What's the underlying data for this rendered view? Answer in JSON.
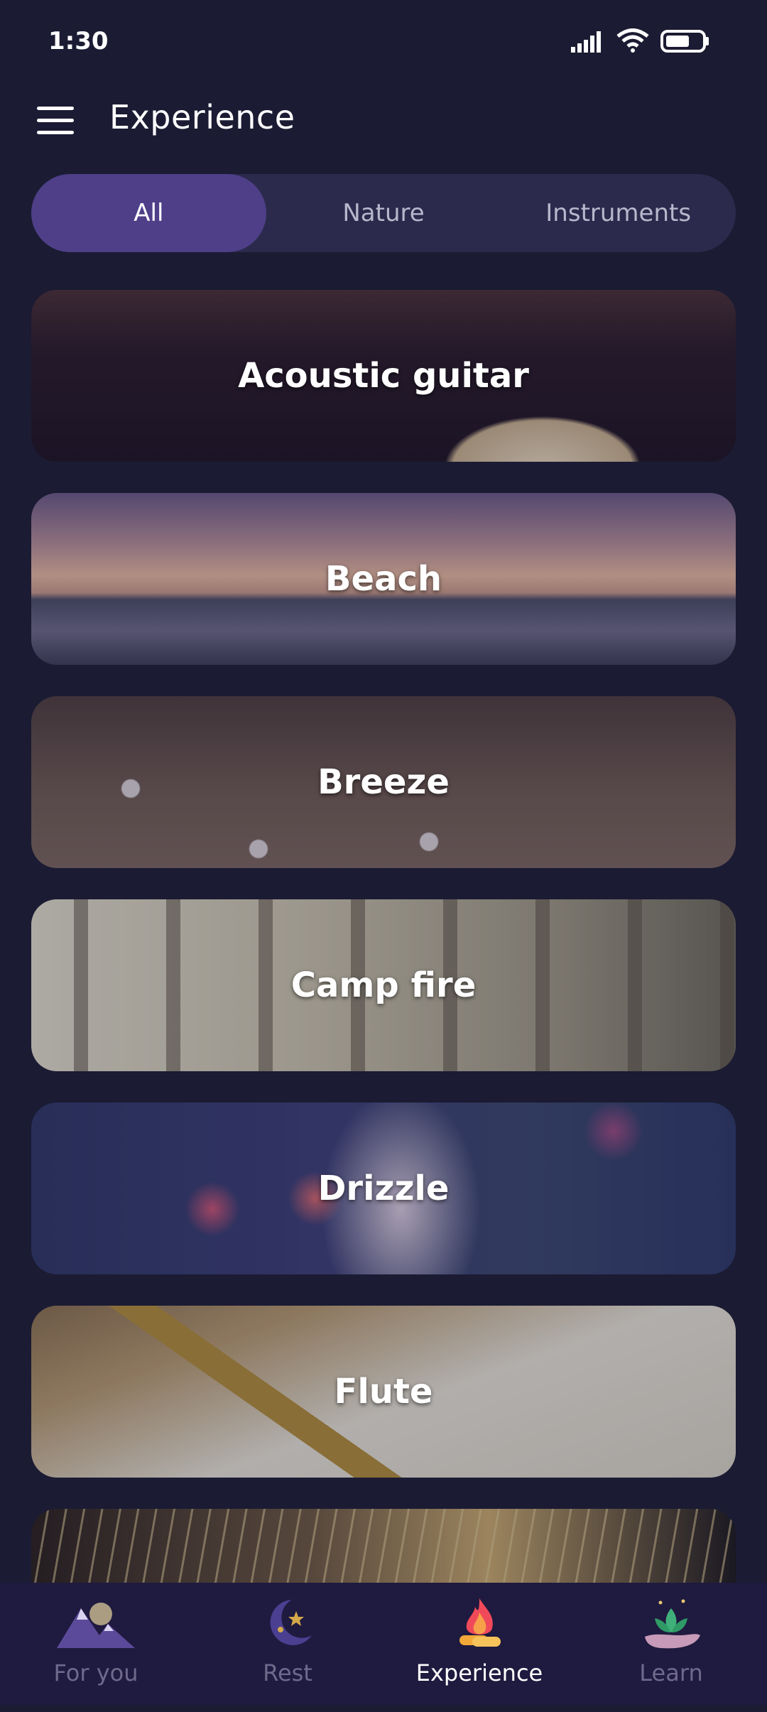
{
  "status_bar": {
    "time": "1:30",
    "icons": [
      "signal-icon",
      "wifi-icon",
      "battery-icon"
    ]
  },
  "app_bar": {
    "menu_icon": "hamburger-menu-icon",
    "title": "Experience"
  },
  "filter_tabs": [
    {
      "label": "All",
      "active": true
    },
    {
      "label": "Nature",
      "active": false
    },
    {
      "label": "Instruments",
      "active": false
    }
  ],
  "sounds": [
    {
      "label": "Acoustic guitar"
    },
    {
      "label": "Beach"
    },
    {
      "label": "Breeze"
    },
    {
      "label": "Camp fire"
    },
    {
      "label": "Drizzle"
    },
    {
      "label": "Flute"
    },
    {
      "label": ""
    }
  ],
  "bottom_nav": [
    {
      "label": "For you",
      "icon": "mountains-icon",
      "active": false
    },
    {
      "label": "Rest",
      "icon": "moon-stars-icon",
      "active": false
    },
    {
      "label": "Experience",
      "icon": "campfire-icon",
      "active": true
    },
    {
      "label": "Learn",
      "icon": "lotus-hand-icon",
      "active": false
    }
  ],
  "colors": {
    "background": "#1b1b33",
    "active_tab": "#4e3f88",
    "nav_background": "#1f1a3f",
    "inactive_text": "#6f6a8c"
  }
}
